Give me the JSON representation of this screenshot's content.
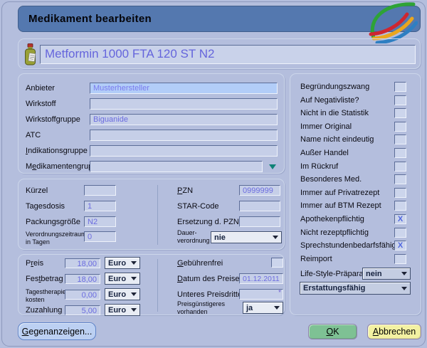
{
  "window": {
    "title": "Medikament bearbeiten"
  },
  "header": {
    "medication_name": "Metformin 1000 FTA 120 ST N2"
  },
  "colors": {
    "background": "#b4bedd",
    "titlebar": "#5478af",
    "field_text": "#6c6ce0",
    "ok_button": "#7ec194",
    "cancel_button": "#f3f1a2",
    "logo_green": "#2ea336",
    "logo_red": "#cf2630",
    "logo_yellow": "#eaa61e",
    "logo_blue": "#2e7fc2"
  },
  "fields": {
    "anbieter": {
      "label": {
        "pre": "Anbieter"
      },
      "value": "Musterhersteller"
    },
    "wirkstoff": {
      "label": {
        "pre": "Wirkstoff"
      },
      "value": ""
    },
    "wirkstoffgruppe": {
      "label": {
        "pre": "Wirkstoffgruppe"
      },
      "value": "Biguanide"
    },
    "atc": {
      "label": {
        "pre": "ATC"
      },
      "value": ""
    },
    "indikationsgruppe": {
      "label": {
        "pre": "",
        "u": "I",
        "post": "ndikationsgruppe"
      },
      "value": ""
    },
    "medikamentengruppe": {
      "label": {
        "pre": "M",
        "u": "e",
        "post": "dikamentengruppe"
      },
      "value": ""
    }
  },
  "codes": {
    "kuerzel": {
      "label": {
        "pre": "Kürzel"
      },
      "value": ""
    },
    "tagesdosis": {
      "label": {
        "pre": "Tagesdosis"
      },
      "value": "1"
    },
    "packungsgroesse": {
      "label": {
        "pre": "Packungsgröße"
      },
      "value": "N2"
    },
    "verordnungszeitraum": {
      "label_line1": "Verordnungszeitraum",
      "label_line2": "in Tagen",
      "value": "0"
    },
    "pzn": {
      "label": {
        "pre": "",
        "u": "P",
        "post": "ZN"
      },
      "value": "0999999"
    },
    "star_code": {
      "label": {
        "pre": "STAR-Code"
      },
      "value": ""
    },
    "ersetzung_pzn": {
      "label": {
        "pre": "Ersetzung d. PZN"
      },
      "value": ""
    },
    "dauerverordnung": {
      "label_line1": "Dauer-",
      "label_line2": "verordnung",
      "value": "nie"
    }
  },
  "prices": {
    "preis": {
      "label": {
        "pre": "P",
        "u": "r",
        "post": "eis"
      },
      "value": "18,00",
      "currency": "Euro"
    },
    "festbetrag": {
      "label": {
        "pre": "Fes",
        "u": "t",
        "post": "betrag"
      },
      "value": "18,00",
      "currency": "Euro"
    },
    "tagestherapiekosten": {
      "label_line1": "Tagestherapie-",
      "label_line2": "kosten",
      "value": "0,00",
      "currency": "Euro"
    },
    "zuzahlung": {
      "label": {
        "pre": "Zuzahlung"
      },
      "value": "5,00",
      "currency": "Euro"
    },
    "gebuehrenfrei": {
      "label": {
        "pre": "",
        "u": "G",
        "post": "ebührenfrei"
      },
      "mark": ""
    },
    "datum_des_preises": {
      "label": {
        "pre": "",
        "u": "D",
        "post": "atum des Preises"
      },
      "value": "01.12.2011"
    },
    "unteres_preisdrittel": {
      "label": {
        "pre": "Unteres Preisdrittel"
      },
      "value": "",
      "asterisk": "*"
    },
    "preisguenstigeres": {
      "label_line1": "Preisgünstigeres",
      "label_line2": "vorhanden",
      "value": "ja"
    }
  },
  "flags": {
    "items": [
      {
        "label": "Begründungszwang",
        "mark": ""
      },
      {
        "label": "Auf Negativliste?",
        "mark": ""
      },
      {
        "label": "Nicht in die Statistik",
        "mark": ""
      },
      {
        "label": "Immer Original",
        "mark": ""
      },
      {
        "label": "Name nicht eindeutig",
        "mark": ""
      },
      {
        "label": "Außer Handel",
        "mark": ""
      },
      {
        "label": "Im Rückruf",
        "mark": ""
      },
      {
        "label": "Besonderes Med.",
        "mark": ""
      },
      {
        "label": "Immer auf Privatrezept",
        "mark": ""
      },
      {
        "label": "Immer auf BTM Rezept",
        "mark": ""
      },
      {
        "label": "Apothekenpflichtig",
        "mark": "X"
      },
      {
        "label": "Nicht rezeptpflichtig",
        "mark": ""
      },
      {
        "label": "Sprechstundenbedarfsfähig",
        "mark": "X"
      },
      {
        "label": "Reimport",
        "mark": ""
      }
    ],
    "life_style": {
      "label": "Life-Style-Präparat",
      "value": "nein"
    },
    "erstattung": {
      "value": "Erstattungsfähig"
    }
  },
  "buttons": {
    "gegenanzeigen": {
      "pre": "",
      "u": "G",
      "post": "egenanzeigen..."
    },
    "ok": {
      "pre": "",
      "u": "O",
      "post": "K"
    },
    "abbrechen": {
      "pre": "",
      "u": "A",
      "post": "bbrechen"
    }
  }
}
